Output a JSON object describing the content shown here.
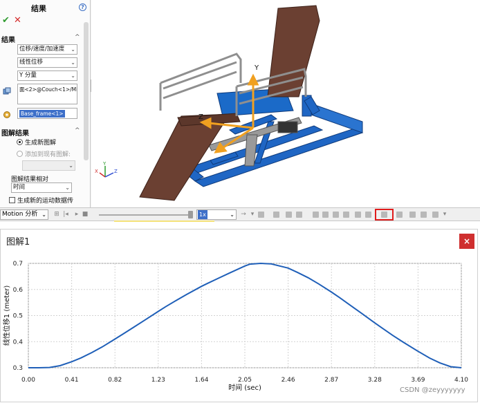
{
  "property_manager": {
    "title": "结果",
    "help_icon": "?",
    "ok_icon": "✔",
    "cancel_icon": "✕",
    "results_section": "结果",
    "dropdown_category": "位移/速度/加速度",
    "dropdown_subcategory": "线性位移",
    "dropdown_component": "Y 分量",
    "face_ref": "面<2>@Couch<1>/Mic",
    "ref_component": "Base_frame<1>",
    "plot_results_section": "图解结果",
    "radio_new": "生成新图解",
    "radio_existing": "添加到现有图解:",
    "plot_against_label": "图解结果相对",
    "plot_against_value": "时间",
    "checkbox_create_motion": "生成新的运动数据传"
  },
  "motion_bar": {
    "study_type": "Motion 分析",
    "speed": "1x"
  },
  "viewport": {
    "axis_y": "Y",
    "axis_z": "Z",
    "triad_y": "Y",
    "triad_x": "X",
    "triad_z": "Z"
  },
  "graph_window": {
    "title": "图解1",
    "close": "×"
  },
  "chart_data": {
    "type": "line",
    "title": "",
    "xlabel": "时间 (sec)",
    "ylabel": "线性位移1 (meter)",
    "xlim": [
      0.0,
      4.1
    ],
    "ylim": [
      0.3,
      0.7
    ],
    "xticks": [
      "0.00",
      "0.41",
      "0.82",
      "1.23",
      "1.64",
      "2.05",
      "2.46",
      "2.87",
      "3.28",
      "3.69",
      "4.10"
    ],
    "yticks": [
      "0.3",
      "0.4",
      "0.5",
      "0.6",
      "0.7"
    ],
    "grid": true,
    "series": [
      {
        "color": "#1f5fb8",
        "x": [
          0.0,
          0.1,
          0.2,
          0.3,
          0.41,
          0.5,
          0.6,
          0.7,
          0.82,
          0.9,
          1.0,
          1.1,
          1.23,
          1.3,
          1.4,
          1.5,
          1.64,
          1.7,
          1.8,
          1.9,
          2.05,
          2.1,
          2.2,
          2.3,
          2.46,
          2.55,
          2.65,
          2.75,
          2.87,
          2.95,
          3.05,
          3.15,
          3.28,
          3.35,
          3.45,
          3.55,
          3.69,
          3.8,
          3.9,
          4.0,
          4.1
        ],
        "y": [
          0.3,
          0.3,
          0.301,
          0.308,
          0.323,
          0.338,
          0.358,
          0.38,
          0.41,
          0.43,
          0.456,
          0.482,
          0.516,
          0.534,
          0.558,
          0.581,
          0.612,
          0.624,
          0.643,
          0.662,
          0.69,
          0.697,
          0.7,
          0.698,
          0.682,
          0.665,
          0.645,
          0.621,
          0.59,
          0.568,
          0.539,
          0.51,
          0.472,
          0.452,
          0.424,
          0.398,
          0.363,
          0.337,
          0.318,
          0.304,
          0.3
        ]
      }
    ]
  }
}
